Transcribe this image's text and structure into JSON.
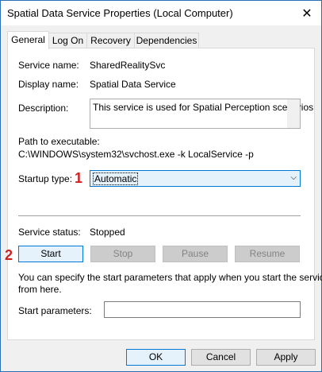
{
  "window": {
    "title": "Spatial Data Service Properties (Local Computer)",
    "close_glyph": "✕"
  },
  "tabs": [
    {
      "label": "General",
      "active": true
    },
    {
      "label": "Log On",
      "active": false
    },
    {
      "label": "Recovery",
      "active": false
    },
    {
      "label": "Dependencies",
      "active": false
    }
  ],
  "general": {
    "service_name_label": "Service name:",
    "service_name_value": "SharedRealitySvc",
    "display_name_label": "Display name:",
    "display_name_value": "Spatial Data Service",
    "description_label": "Description:",
    "description_value": "This service is used for Spatial Perception scenarios",
    "path_label": "Path to executable:",
    "path_value": "C:\\WINDOWS\\system32\\svchost.exe -k LocalService -p",
    "startup_type_label": "Startup type:",
    "startup_type_value": "Automatic",
    "service_status_label": "Service status:",
    "service_status_value": "Stopped",
    "buttons": {
      "start": "Start",
      "stop": "Stop",
      "pause": "Pause",
      "resume": "Resume"
    },
    "help_text_line1": "You can specify the start parameters that apply when you start the service",
    "help_text_line2": "from here.",
    "start_params_label": "Start parameters:",
    "start_params_value": ""
  },
  "footer": {
    "ok": "OK",
    "cancel": "Cancel",
    "apply": "Apply"
  },
  "annotations": {
    "marker1": "1",
    "marker2": "2",
    "color": "#d02020"
  }
}
